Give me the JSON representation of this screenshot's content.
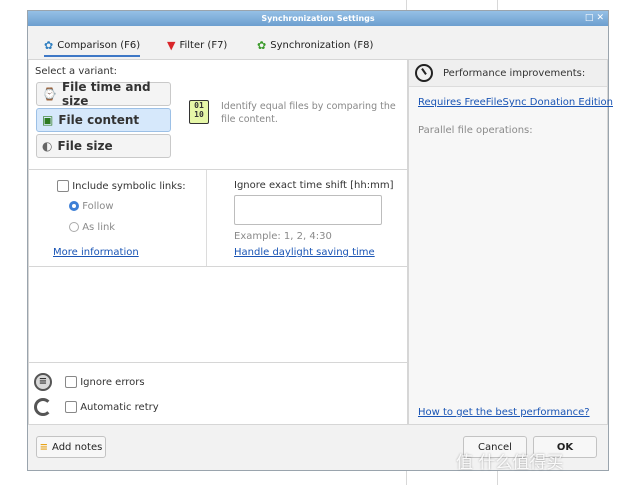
{
  "window": {
    "title": "Synchronization Settings",
    "buttons": "□ ✕"
  },
  "tabs": [
    {
      "label": "Comparison (F6)",
      "icon": "gear-icon"
    },
    {
      "label": "Filter (F7)",
      "icon": "filter-icon"
    },
    {
      "label": "Synchronization (F8)",
      "icon": "gear-icon"
    }
  ],
  "variants": {
    "label": "Select a variant:",
    "items": [
      {
        "label": "File time and size",
        "icon": "clock-file-icon"
      },
      {
        "label": "File content",
        "icon": "binary-file-icon"
      },
      {
        "label": "File size",
        "icon": "size-icon"
      }
    ],
    "selected_index": 1,
    "description": "Identify equal files by comparing the file content.",
    "big_icon_text": "01\n10"
  },
  "symlinks": {
    "label": "Include symbolic links:",
    "option_follow": "Follow",
    "option_as_link": "As link",
    "more_info": "More information"
  },
  "timeshift": {
    "label": "Ignore exact time shift [hh:mm]",
    "value": "",
    "example": "Example: 1, 2, 4:30",
    "dst_link": "Handle daylight saving time"
  },
  "errors": {
    "ignore_label": "Ignore errors",
    "retry_label": "Automatic retry"
  },
  "performance": {
    "title": "Performance improvements:",
    "donation_link": "Requires FreeFileSync Donation Edition",
    "parallel_label": "Parallel file operations:",
    "best_link": "How to get the best performance?"
  },
  "footer": {
    "notes_label": "Add notes",
    "cancel_label": "Cancel",
    "ok_label": "OK"
  },
  "watermark": "值 什么值得买"
}
